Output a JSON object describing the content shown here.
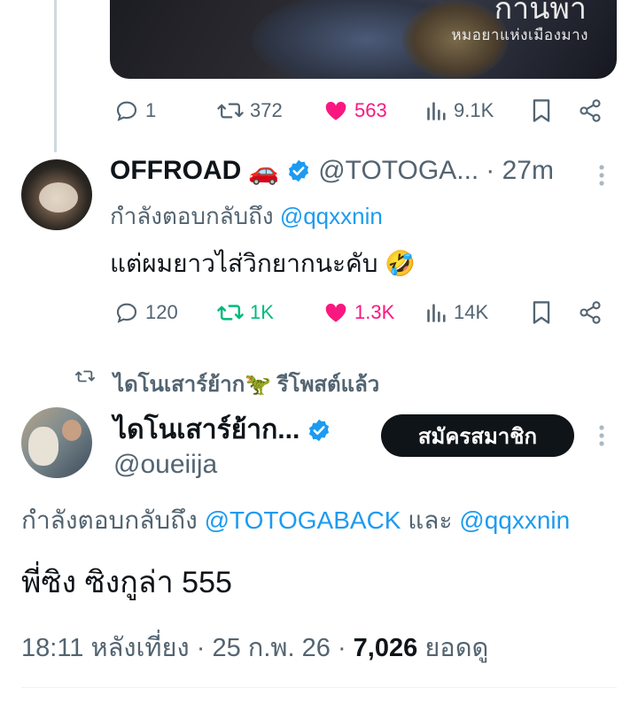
{
  "media": {
    "title": "กานพา",
    "subtitle": "หมอยาแห่งเมืองมาง"
  },
  "tweet1_actions": {
    "replies": "1",
    "retweets": "372",
    "likes": "563",
    "views": "9.1K"
  },
  "reply_tweet": {
    "name": "OFFROAD",
    "name_emoji": "🚗",
    "handle": "@TOTOGA...",
    "time": "· 27m",
    "replying_label": "กำลังตอบกลับถึง",
    "replying_handle": "@qqxxnin",
    "text": "แต่ผมยาวไส่วิกยากนะคับ",
    "text_emoji": "🤣",
    "actions": {
      "replies": "120",
      "retweets": "1K",
      "likes": "1.3K",
      "views": "14K"
    }
  },
  "main_tweet": {
    "retweet_label": "ไดโนเสาร์ย้าก🦖 รีโพสต์แล้ว",
    "name": "ไดโนเสาร์ย้าก...",
    "handle": "@oueiija",
    "subscribe_label": "สมัครสมาชิก",
    "replying_label": "กำลังตอบกลับถึง",
    "replying_handle1": "@TOTOGABACK",
    "replying_and": "และ",
    "replying_handle2": "@qqxxnin",
    "text": "พี่ซิง ซิงกูล่า 555",
    "timestamp": "18:11 หลังเที่ยง · 25 ก.พ. 26 ·",
    "views_count": "7,026",
    "views_label": "ยอดดู"
  },
  "colors": {
    "like": "#f91880",
    "retweet_active": "#00ba7c",
    "link": "#1d9bf0",
    "verified": "#1d9bf0",
    "muted": "#536471"
  }
}
